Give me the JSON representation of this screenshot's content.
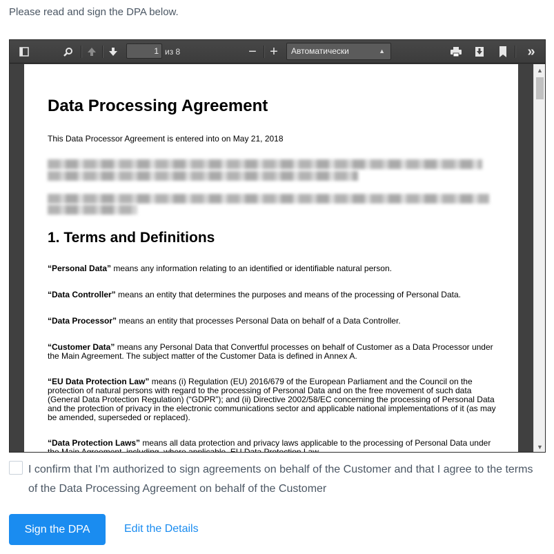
{
  "intro": "Please read and sign the DPA below.",
  "viewer": {
    "toolbar": {
      "sidebar_icon": "sidebar-toggle-icon",
      "search_icon": "search-icon",
      "prev_icon": "arrow-up-icon",
      "next_icon": "arrow-down-icon",
      "page_number": "1",
      "page_count": "из 8",
      "zoom_out_label": "−",
      "zoom_in_label": "+",
      "zoom_value": "Автоматически",
      "print_icon": "print-icon",
      "download_icon": "download-icon",
      "bookmark_icon": "bookmark-icon",
      "tools_label": "»"
    },
    "document": {
      "title": "Data Processing Agreement",
      "intro": "This Data Processor Agreement is entered into on May 21, 2018",
      "section_title": "1. Terms and Definitions",
      "definitions": [
        {
          "term": "“Personal Data”",
          "text": " means any information relating to an identified or identifiable natural person."
        },
        {
          "term": "“Data Controller”",
          "text": " means an entity that determines the purposes and means of the processing of Personal Data."
        },
        {
          "term": "“Data Processor”",
          "text": " means an entity that processes Personal Data on behalf of a Data Controller."
        },
        {
          "term": "“Customer Data”",
          "text": " means any Personal Data that Convertful processes on behalf of Customer as a Data Processor under the Main Agreement. The subject matter of the Customer Data is defined in Annex A."
        },
        {
          "term": "“EU Data Protection Law”",
          "text": " means (i) Regulation (EU) 2016/679 of the European Parliament and the Council on the protection of natural persons with regard to the processing of Personal Data and on the free movement of such data (General Data Protection Regulation) (“GDPR”); and (ii) Directive 2002/58/EC concerning the processing of Personal Data and the protection of privacy in the electronic communications sector and applicable national implementations of it (as may be amended, superseded or replaced)."
        },
        {
          "term": "“Data Protection Laws”",
          "text": " means all data protection and privacy laws applicable to the processing of Personal Data under the Main Agreement, including, where applicable, EU Data Protection Law."
        }
      ]
    }
  },
  "confirm_label": "I confirm that I'm authorized to sign agreements on behalf of the Customer and that I agree to the terms of the Data Processing Agreement on behalf of the Customer",
  "sign_button": "Sign the DPA",
  "edit_link": "Edit the Details",
  "colors": {
    "accent": "#1a8cf0",
    "toolbar": "#474747",
    "viewer_bg": "#404040"
  }
}
